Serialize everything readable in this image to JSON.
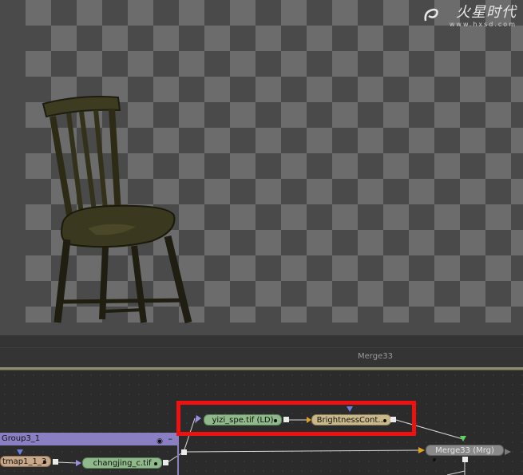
{
  "viewer": {
    "logo_text": "火星时代",
    "logo_url": "www.hxsd.com"
  },
  "status": {
    "viewer_label": "Merge33"
  },
  "flow": {
    "group_title": "Group3_1",
    "group_minimize": "–",
    "nodes": {
      "yizi": "yizi_spe.tif  (LD)",
      "brightness": "BrightnessCont…",
      "merge": "Merge33  (Mrg)",
      "changjing": "changjing_c.tif",
      "tmap": "tmap1_1_3"
    }
  },
  "colors": {
    "loader_node": "#8fb98a",
    "color_node": "#c9b98a",
    "merge_node": "#8a8a8a",
    "group_header": "#8a7fc2",
    "highlight": "#ee1111"
  }
}
